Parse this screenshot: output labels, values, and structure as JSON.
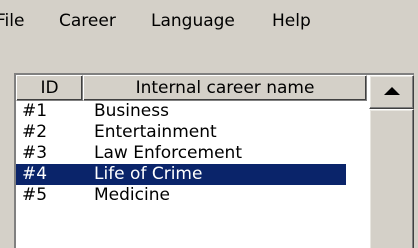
{
  "menubar": {
    "items": [
      {
        "label": "File"
      },
      {
        "label": "Career"
      },
      {
        "label": "Language"
      },
      {
        "label": "Help"
      }
    ]
  },
  "list": {
    "columns": [
      {
        "label": "ID"
      },
      {
        "label": "Internal career name"
      }
    ],
    "rows": [
      {
        "id": "#1",
        "name": "Business",
        "selected": false
      },
      {
        "id": "#2",
        "name": "Entertainment",
        "selected": false
      },
      {
        "id": "#3",
        "name": "Law Enforcement",
        "selected": false
      },
      {
        "id": "#4",
        "name": "Life of Crime",
        "selected": true
      },
      {
        "id": "#5",
        "name": "Medicine",
        "selected": false
      }
    ]
  },
  "scrollbar": {
    "up_icon": "arrow-up-icon"
  },
  "colors": {
    "selection": "#0a246a",
    "face": "#d4d0c8"
  }
}
